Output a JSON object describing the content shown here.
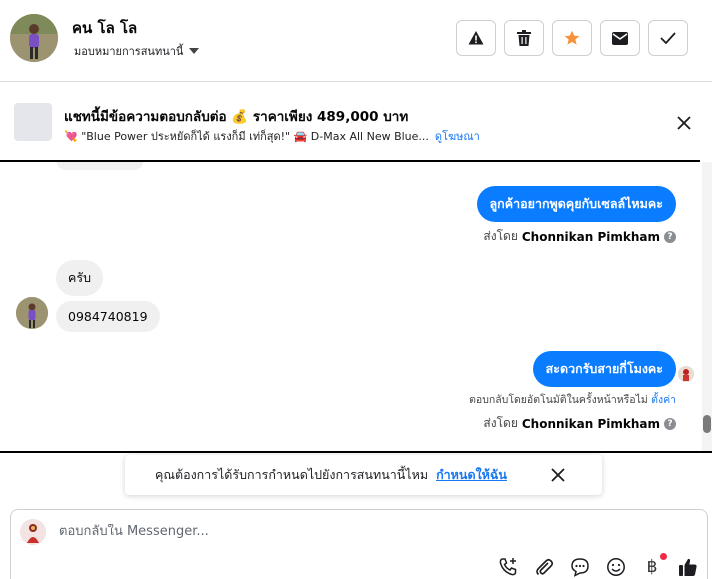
{
  "header": {
    "contact_name": "คน โล โล",
    "assign_label": "มอบหมายการสนทนานี้",
    "actions": [
      {
        "name": "report-button",
        "icon": "warning-icon"
      },
      {
        "name": "delete-button",
        "icon": "trash-icon"
      },
      {
        "name": "star-button",
        "icon": "star-icon"
      },
      {
        "name": "mark-unread-button",
        "icon": "envelope-icon"
      },
      {
        "name": "mark-done-button",
        "icon": "check-icon"
      }
    ]
  },
  "ad_banner": {
    "title": "แชทนี้มีข้อความตอบกลับต่อ 💰 ราคาเพียง 489,000 บาท",
    "subtitle": "💘 \"Blue Power ประหยัดก็ได้ แรงก็มี เท่ก็สุด!\" 🚘 D-Max All New Blue...",
    "link": "ดูโฆษณา"
  },
  "messages": {
    "out1": "ลูกค้าอยากพูดคุยกับเซลล์ไหมคะ",
    "out1_sent_prefix": "ส่งโดย",
    "out1_sender": "Chonnikan Pimkham",
    "in1": "ครับ",
    "in2": "0984740819",
    "out2": "สะดวกรับสายกี่โมงคะ",
    "auto_reply_note": "ตอบกลับโดยอัตโนมัติในครั้งหน้าหรือไม่",
    "auto_reply_link": "ตั้งค่า",
    "out2_sent_prefix": "ส่งโดย",
    "out2_sender": "Chonnikan Pimkham"
  },
  "toast": {
    "text": "คุณต้องการได้รับการกำหนดไปยังการสนทนานี้ไหม",
    "link": "กำหนดให้ฉัน"
  },
  "composer": {
    "placeholder": "ตอบกลับใน Messenger...",
    "baht_symbol": "฿"
  },
  "colors": {
    "outgoing_bubble": "#0a7cff",
    "incoming_bubble": "#f0f0f0",
    "link": "#1877f2",
    "star": "#f7923b"
  }
}
